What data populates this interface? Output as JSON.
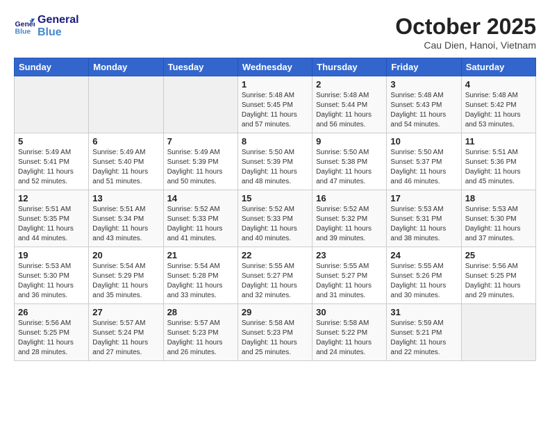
{
  "header": {
    "logo_line1": "General",
    "logo_line2": "Blue",
    "month_title": "October 2025",
    "location": "Cau Dien, Hanoi, Vietnam"
  },
  "days_of_week": [
    "Sunday",
    "Monday",
    "Tuesday",
    "Wednesday",
    "Thursday",
    "Friday",
    "Saturday"
  ],
  "weeks": [
    [
      {
        "day": "",
        "info": ""
      },
      {
        "day": "",
        "info": ""
      },
      {
        "day": "",
        "info": ""
      },
      {
        "day": "1",
        "info": "Sunrise: 5:48 AM\nSunset: 5:45 PM\nDaylight: 11 hours and 57 minutes."
      },
      {
        "day": "2",
        "info": "Sunrise: 5:48 AM\nSunset: 5:44 PM\nDaylight: 11 hours and 56 minutes."
      },
      {
        "day": "3",
        "info": "Sunrise: 5:48 AM\nSunset: 5:43 PM\nDaylight: 11 hours and 54 minutes."
      },
      {
        "day": "4",
        "info": "Sunrise: 5:48 AM\nSunset: 5:42 PM\nDaylight: 11 hours and 53 minutes."
      }
    ],
    [
      {
        "day": "5",
        "info": "Sunrise: 5:49 AM\nSunset: 5:41 PM\nDaylight: 11 hours and 52 minutes."
      },
      {
        "day": "6",
        "info": "Sunrise: 5:49 AM\nSunset: 5:40 PM\nDaylight: 11 hours and 51 minutes."
      },
      {
        "day": "7",
        "info": "Sunrise: 5:49 AM\nSunset: 5:39 PM\nDaylight: 11 hours and 50 minutes."
      },
      {
        "day": "8",
        "info": "Sunrise: 5:50 AM\nSunset: 5:39 PM\nDaylight: 11 hours and 48 minutes."
      },
      {
        "day": "9",
        "info": "Sunrise: 5:50 AM\nSunset: 5:38 PM\nDaylight: 11 hours and 47 minutes."
      },
      {
        "day": "10",
        "info": "Sunrise: 5:50 AM\nSunset: 5:37 PM\nDaylight: 11 hours and 46 minutes."
      },
      {
        "day": "11",
        "info": "Sunrise: 5:51 AM\nSunset: 5:36 PM\nDaylight: 11 hours and 45 minutes."
      }
    ],
    [
      {
        "day": "12",
        "info": "Sunrise: 5:51 AM\nSunset: 5:35 PM\nDaylight: 11 hours and 44 minutes."
      },
      {
        "day": "13",
        "info": "Sunrise: 5:51 AM\nSunset: 5:34 PM\nDaylight: 11 hours and 43 minutes."
      },
      {
        "day": "14",
        "info": "Sunrise: 5:52 AM\nSunset: 5:33 PM\nDaylight: 11 hours and 41 minutes."
      },
      {
        "day": "15",
        "info": "Sunrise: 5:52 AM\nSunset: 5:33 PM\nDaylight: 11 hours and 40 minutes."
      },
      {
        "day": "16",
        "info": "Sunrise: 5:52 AM\nSunset: 5:32 PM\nDaylight: 11 hours and 39 minutes."
      },
      {
        "day": "17",
        "info": "Sunrise: 5:53 AM\nSunset: 5:31 PM\nDaylight: 11 hours and 38 minutes."
      },
      {
        "day": "18",
        "info": "Sunrise: 5:53 AM\nSunset: 5:30 PM\nDaylight: 11 hours and 37 minutes."
      }
    ],
    [
      {
        "day": "19",
        "info": "Sunrise: 5:53 AM\nSunset: 5:30 PM\nDaylight: 11 hours and 36 minutes."
      },
      {
        "day": "20",
        "info": "Sunrise: 5:54 AM\nSunset: 5:29 PM\nDaylight: 11 hours and 35 minutes."
      },
      {
        "day": "21",
        "info": "Sunrise: 5:54 AM\nSunset: 5:28 PM\nDaylight: 11 hours and 33 minutes."
      },
      {
        "day": "22",
        "info": "Sunrise: 5:55 AM\nSunset: 5:27 PM\nDaylight: 11 hours and 32 minutes."
      },
      {
        "day": "23",
        "info": "Sunrise: 5:55 AM\nSunset: 5:27 PM\nDaylight: 11 hours and 31 minutes."
      },
      {
        "day": "24",
        "info": "Sunrise: 5:55 AM\nSunset: 5:26 PM\nDaylight: 11 hours and 30 minutes."
      },
      {
        "day": "25",
        "info": "Sunrise: 5:56 AM\nSunset: 5:25 PM\nDaylight: 11 hours and 29 minutes."
      }
    ],
    [
      {
        "day": "26",
        "info": "Sunrise: 5:56 AM\nSunset: 5:25 PM\nDaylight: 11 hours and 28 minutes."
      },
      {
        "day": "27",
        "info": "Sunrise: 5:57 AM\nSunset: 5:24 PM\nDaylight: 11 hours and 27 minutes."
      },
      {
        "day": "28",
        "info": "Sunrise: 5:57 AM\nSunset: 5:23 PM\nDaylight: 11 hours and 26 minutes."
      },
      {
        "day": "29",
        "info": "Sunrise: 5:58 AM\nSunset: 5:23 PM\nDaylight: 11 hours and 25 minutes."
      },
      {
        "day": "30",
        "info": "Sunrise: 5:58 AM\nSunset: 5:22 PM\nDaylight: 11 hours and 24 minutes."
      },
      {
        "day": "31",
        "info": "Sunrise: 5:59 AM\nSunset: 5:21 PM\nDaylight: 11 hours and 22 minutes."
      },
      {
        "day": "",
        "info": ""
      }
    ]
  ]
}
